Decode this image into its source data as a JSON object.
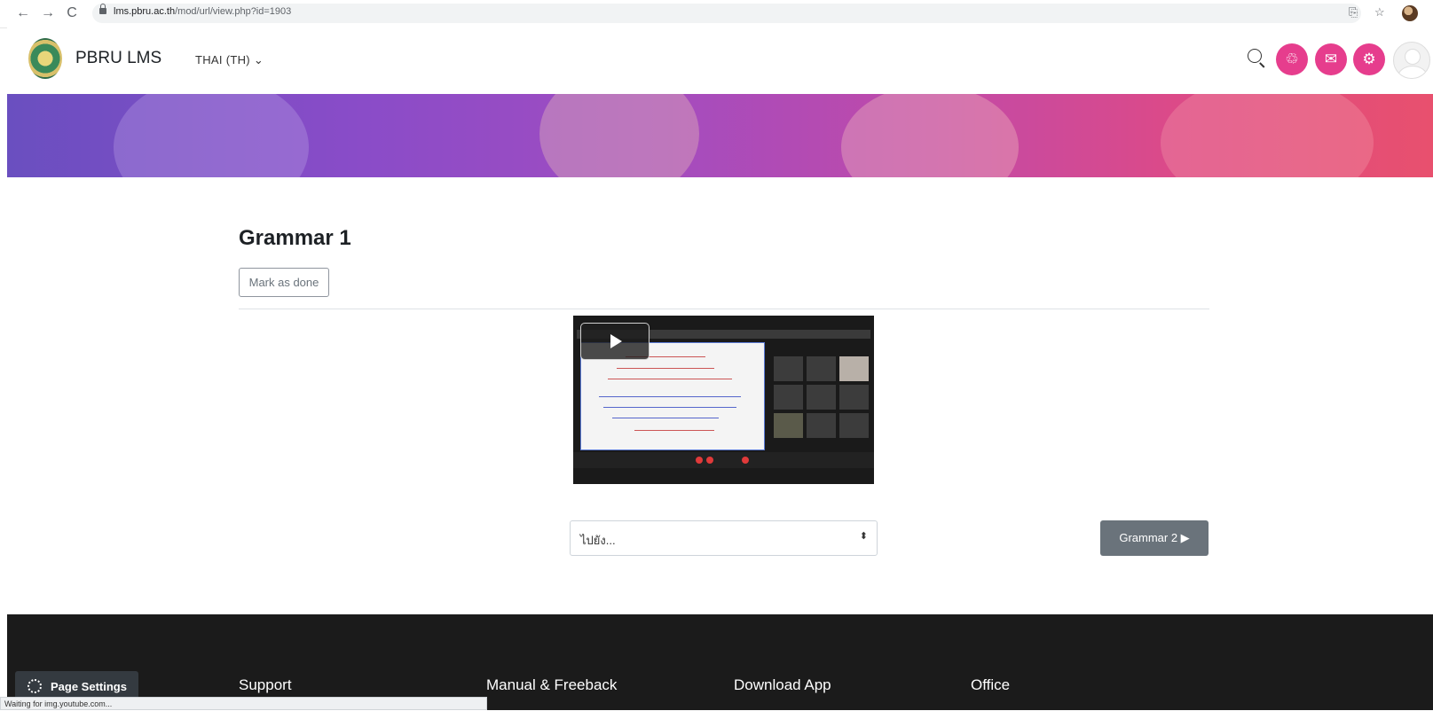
{
  "browser": {
    "url_domain": "lms.pbru.ac.th",
    "url_path": "/mod/url/view.php?id=1903",
    "status_text": "Waiting for img.youtube.com..."
  },
  "navbar": {
    "brand": "PBRU LMS",
    "language": "THAI (TH) ⌄",
    "icons": [
      "search-icon",
      "notification-icon",
      "messages-icon",
      "settings-icon",
      "user-avatar"
    ]
  },
  "content": {
    "title": "Grammar 1",
    "mark_done_label": "Mark as done",
    "jump_placeholder": "ไปยัง...",
    "next_button_label": "Grammar 2 ▶"
  },
  "footer": {
    "page_settings_label": "Page Settings",
    "columns": [
      "Support",
      "Manual & Freeback",
      "Download App",
      "Office"
    ]
  },
  "colors": {
    "accent_pink": "#e63d8d",
    "footer_bg": "#1b1b1b",
    "secondary_button": "#6a737b"
  }
}
